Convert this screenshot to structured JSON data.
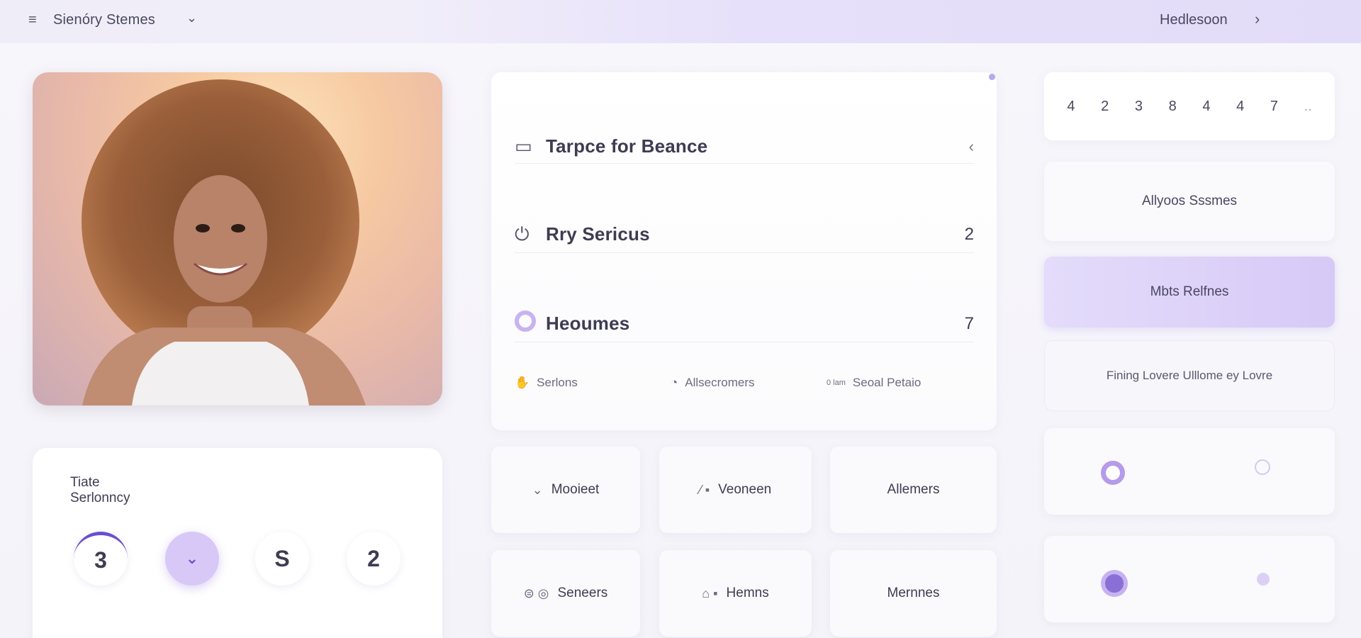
{
  "topbar": {
    "menu_icon": "hamburger-icon",
    "title": "Sienóry Stemes",
    "right_label": "Hedlesoon"
  },
  "main_list": {
    "rows": [
      {
        "label": "Tarpce for Beance",
        "value": "",
        "icon": "bag-icon"
      },
      {
        "label": "Rry Sericus",
        "value": "2",
        "icon": "power-icon"
      },
      {
        "label": "Heoumes",
        "value": "7",
        "icon": "ring-icon"
      }
    ],
    "footer": [
      {
        "label": "Serlons",
        "icon": "hand-icon"
      },
      {
        "label": "Allsecromers",
        "icon": "bell-icon"
      },
      {
        "label": "Seoal Petaio",
        "icon": "tag-icon",
        "prefix": "0 lam"
      }
    ]
  },
  "tiles": [
    {
      "label": "Mooieet",
      "icon": "chevron-down-icon"
    },
    {
      "label": "Veoneen",
      "icon": "edit-icon"
    },
    {
      "label": "Allemers",
      "icon": ""
    },
    {
      "label": "Seneers",
      "icon": "toggle-icon"
    },
    {
      "label": "Hemns",
      "icon": "shirt-icon"
    },
    {
      "label": "Mernnes",
      "icon": ""
    }
  ],
  "numbers": [
    "4",
    "2",
    "3",
    "8",
    "4",
    "4",
    "7",
    ".."
  ],
  "right_buttons": {
    "b1": "Allyoos Sssmes",
    "b2": "Mbts Relfnes",
    "b3": "Fining Lovere Ulllome ey Lovre"
  },
  "stats": {
    "heading_line1": "Tiate",
    "heading_line2": "Serlonncy",
    "circles": [
      "3",
      "",
      "S",
      "2"
    ]
  },
  "colors": {
    "accent": "#b8a8ef",
    "accent_active": "#d7c9f7"
  }
}
